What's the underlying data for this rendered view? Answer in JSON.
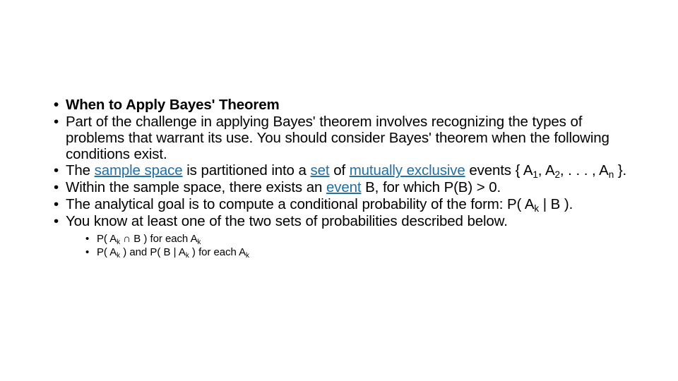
{
  "slide": {
    "bullet_glyph": "•",
    "link_color": "#1F6FA8",
    "text_color": "#000000",
    "background_color": "#FFFFFF",
    "bullets": [
      {
        "id": "heading",
        "bold": true,
        "text": "When to Apply Bayes' Theorem"
      },
      {
        "id": "challenge",
        "bold": false,
        "text": "Part of the challenge in applying Bayes' theorem involves recognizing the types of problems that warrant its use. You should consider Bayes' theorem when the following conditions exist."
      },
      {
        "id": "sample-space",
        "bold": false,
        "segments": {
          "t1": "The ",
          "link1": "sample space",
          "t2": " is partitioned into a ",
          "link2": "set",
          "t3": " of ",
          "link3": "mutually exclusive",
          "t4": " events { A",
          "sub1": "1",
          "t5": ", A",
          "sub2": "2",
          "t6": ", . . . , A",
          "sub3": "n",
          "t7": " }."
        }
      },
      {
        "id": "event-b",
        "bold": false,
        "segments": {
          "t1": "Within the sample space, there exists an ",
          "link1": "event",
          "t2": " B, for which P(B) > 0."
        }
      },
      {
        "id": "analytical-goal",
        "bold": false,
        "segments": {
          "t1": "The analytical goal is to compute a conditional probability of the form: P( A",
          "sub1": "k",
          "t2": " | B )."
        }
      },
      {
        "id": "two-sets",
        "bold": false,
        "text": "You know at least one of the two sets of probabilities described below.",
        "sub_bullets": [
          {
            "id": "joint-probability",
            "segments": {
              "t1": "P( A",
              "sub1": "k",
              "t2": " ∩ B ) for each A",
              "sub2": "k"
            }
          },
          {
            "id": "conditional-probability",
            "segments": {
              "t1": "P( A",
              "sub1": "k",
              "t2": " ) and P( B | A",
              "sub2": "k",
              "t3": " ) for each A",
              "sub3": "k"
            }
          }
        ]
      }
    ]
  }
}
